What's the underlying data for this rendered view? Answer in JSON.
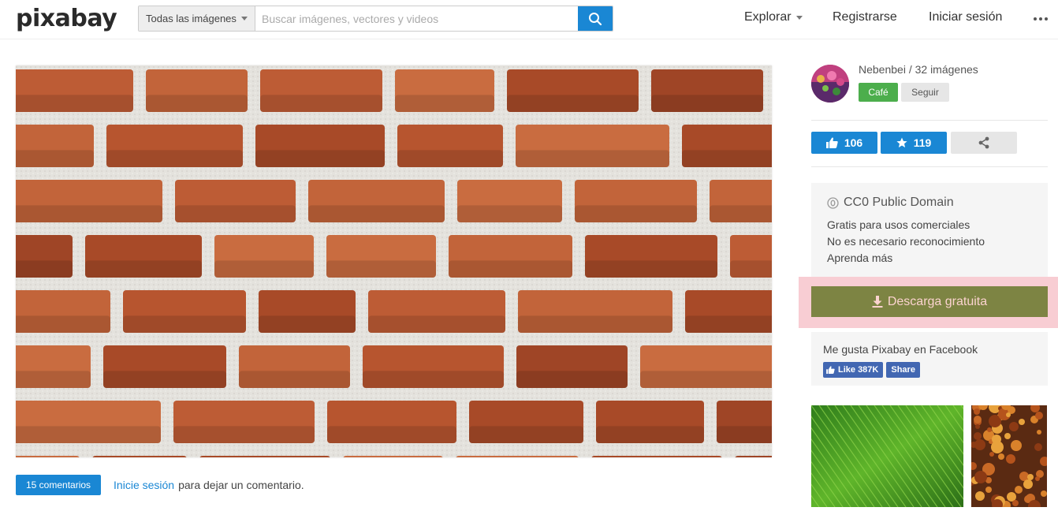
{
  "header": {
    "logo": "pixabay",
    "search": {
      "category": "Todas las imágenes",
      "placeholder": "Buscar imágenes, vectores y videos",
      "value": ""
    },
    "nav": {
      "explore": "Explorar",
      "register": "Registrarse",
      "login": "Iniciar sesión"
    }
  },
  "main": {
    "image_description_icon": "brick-wall-photo",
    "comments": {
      "button_label": "15 comentarios",
      "login_link": "Inicie sesión",
      "suffix": "para dejar un comentario."
    }
  },
  "sidebar": {
    "user": {
      "line": "Nebenbei / 32 imágenes",
      "cafe_label": "Café",
      "follow_label": "Seguir"
    },
    "stats": {
      "likes": "106",
      "favorites": "119"
    },
    "license": {
      "title": "CC0 Public Domain",
      "line1": "Gratis para usos comerciales",
      "line2": "No es necesario reconocimiento",
      "learn_more": "Aprenda más"
    },
    "download_label": "Descarga gratuita",
    "facebook": {
      "text": "Me gusta Pixabay en Facebook",
      "like_label": "Like 387K",
      "share_label": "Share"
    }
  },
  "colors": {
    "accent": "#1a87d4",
    "cafe": "#4cae4c",
    "download": "#7d8443",
    "download_highlight": "#f8cdd3",
    "facebook": "#4267b2"
  }
}
